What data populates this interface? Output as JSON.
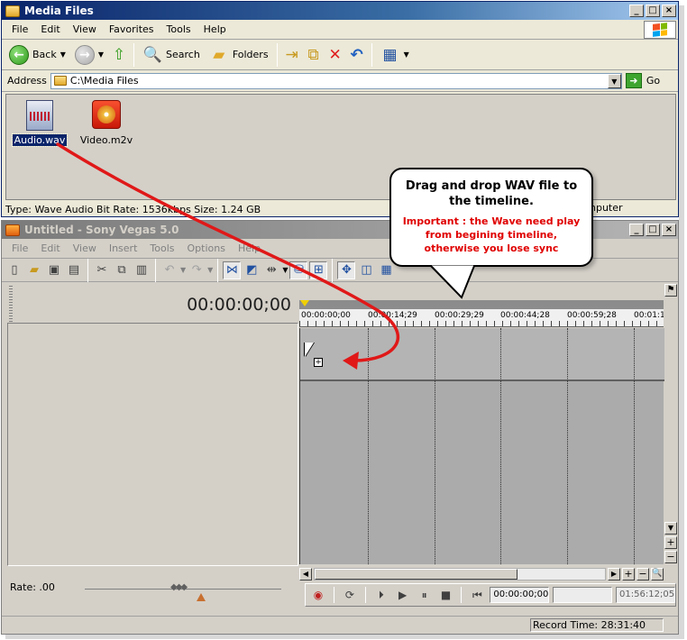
{
  "explorer": {
    "title": "Media Files",
    "menu": [
      "File",
      "Edit",
      "View",
      "Favorites",
      "Tools",
      "Help"
    ],
    "toolbar": {
      "back_label": "Back",
      "search_label": "Search",
      "folders_label": "Folders"
    },
    "address": {
      "label": "Address",
      "value": "C:\\Media Files",
      "go_label": "Go"
    },
    "files": [
      {
        "name": "Audio.wav",
        "selected": true,
        "icon": "wav-file-icon"
      },
      {
        "name": "Video.m2v",
        "selected": false,
        "icon": "video-file-icon"
      }
    ],
    "status": "Type: Wave Audio Bit Rate: 1536kbps Size: 1.24 GB",
    "status_tail": "nputer"
  },
  "vegas": {
    "title": "Untitled - Sony Vegas 5.0",
    "menu": [
      "File",
      "Edit",
      "View",
      "Insert",
      "Tools",
      "Options",
      "Help"
    ],
    "timecode": "00:00:00;00",
    "ruler_labels": [
      "00:00:00;00",
      "00:00:14;29",
      "00:00:29;29",
      "00:00:44;28",
      "00:00:59;28",
      "00:01:1"
    ],
    "rate_label": "Rate: .00",
    "transport": {
      "position": "00:00:00;00",
      "length": "01:56:12;05"
    },
    "record_time": "Record Time: 28:31:40"
  },
  "callout": {
    "title": "Drag and drop WAV file to the timeline.",
    "important_word": "Important",
    "note": " : the Wave need play from begining timeline, otherwise you lose sync"
  },
  "colors": {
    "arrow": "#e01818",
    "note_red": "#e00000",
    "title_active": "#0a246a",
    "selection": "#0a246a"
  }
}
